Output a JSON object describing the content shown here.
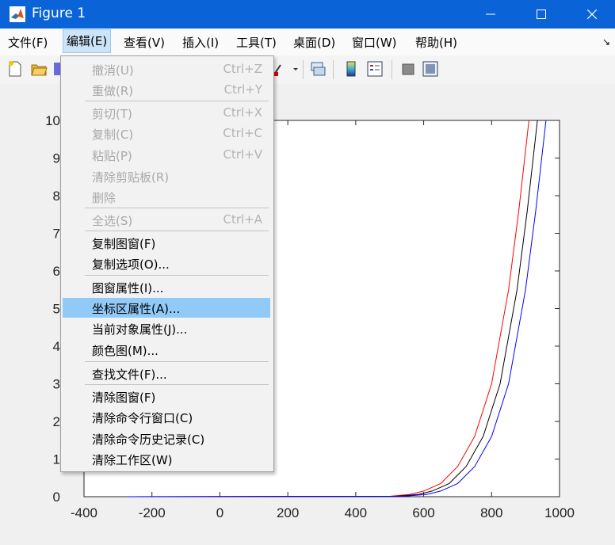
{
  "window": {
    "title": "Figure 1"
  },
  "menubar": {
    "items": [
      "文件(F)",
      "编辑(E)",
      "查看(V)",
      "插入(I)",
      "工具(T)",
      "桌面(D)",
      "窗口(W)",
      "帮助(H)"
    ],
    "active": "编辑(E)"
  },
  "edit_menu": {
    "items": [
      {
        "label": "撤消(U)",
        "shortcut": "Ctrl+Z",
        "enabled": false
      },
      {
        "label": "重做(R)",
        "shortcut": "Ctrl+Y",
        "enabled": false
      },
      {
        "label": "剪切(T)",
        "shortcut": "Ctrl+X",
        "enabled": false
      },
      {
        "label": "复制(C)",
        "shortcut": "Ctrl+C",
        "enabled": false
      },
      {
        "label": "粘贴(P)",
        "shortcut": "Ctrl+V",
        "enabled": false
      },
      {
        "label": "清除剪贴板(R)",
        "shortcut": "",
        "enabled": false
      },
      {
        "label": "删除",
        "shortcut": "",
        "enabled": false
      },
      {
        "label": "全选(S)",
        "shortcut": "Ctrl+A",
        "enabled": false
      },
      {
        "label": "复制图窗(F)",
        "shortcut": "",
        "enabled": true
      },
      {
        "label": "复制选项(O)...",
        "shortcut": "",
        "enabled": true
      },
      {
        "label": "图窗属性(I)...",
        "shortcut": "",
        "enabled": true
      },
      {
        "label": "坐标区属性(A)...",
        "shortcut": "",
        "enabled": true,
        "highlighted": true
      },
      {
        "label": "当前对象属性(J)...",
        "shortcut": "",
        "enabled": true
      },
      {
        "label": "颜色图(M)...",
        "shortcut": "",
        "enabled": true
      },
      {
        "label": "查找文件(F)...",
        "shortcut": "",
        "enabled": true
      },
      {
        "label": "清除图窗(F)",
        "shortcut": "",
        "enabled": true
      },
      {
        "label": "清除命令行窗口(C)",
        "shortcut": "",
        "enabled": true
      },
      {
        "label": "清除命令历史记录(C)",
        "shortcut": "",
        "enabled": true
      },
      {
        "label": "清除工作区(W)",
        "shortcut": "",
        "enabled": true
      }
    ]
  },
  "toolbar": {
    "icons": [
      "new-figure-icon",
      "open-file-icon",
      "save-icon",
      "brush-icon",
      "link-plot-icon",
      "insert-colorbar-icon",
      "insert-legend-icon",
      "hide-plot-tools-icon",
      "show-plot-tools-icon"
    ]
  },
  "chart_data": {
    "type": "line",
    "xlim": [
      -400,
      1000
    ],
    "ylim": [
      0,
      10
    ],
    "xticks": [
      "-400",
      "-200",
      "0",
      "200",
      "400",
      "600",
      "800",
      "1000"
    ],
    "yticks": [
      "0",
      "1",
      "2",
      "3",
      "4",
      "5",
      "6",
      "7",
      "8",
      "9",
      "10"
    ],
    "grid": false,
    "series": [
      {
        "color": "#ff0000",
        "x": [
          -270,
          500,
          560,
          600,
          650,
          700,
          750,
          800,
          850,
          880,
          910
        ],
        "y": [
          0,
          0.01,
          0.06,
          0.15,
          0.35,
          0.8,
          1.6,
          3.0,
          5.5,
          7.6,
          10
        ]
      },
      {
        "color": "#000000",
        "x": [
          -270,
          520,
          585,
          625,
          675,
          725,
          775,
          825,
          875,
          905,
          935
        ],
        "y": [
          0,
          0.01,
          0.06,
          0.15,
          0.35,
          0.8,
          1.6,
          3.0,
          5.5,
          7.6,
          10
        ]
      },
      {
        "color": "#0000ff",
        "x": [
          -270,
          540,
          610,
          650,
          700,
          750,
          800,
          850,
          900,
          930,
          960
        ],
        "y": [
          0,
          0.01,
          0.06,
          0.15,
          0.35,
          0.8,
          1.6,
          3.0,
          5.5,
          7.6,
          10
        ]
      }
    ]
  }
}
